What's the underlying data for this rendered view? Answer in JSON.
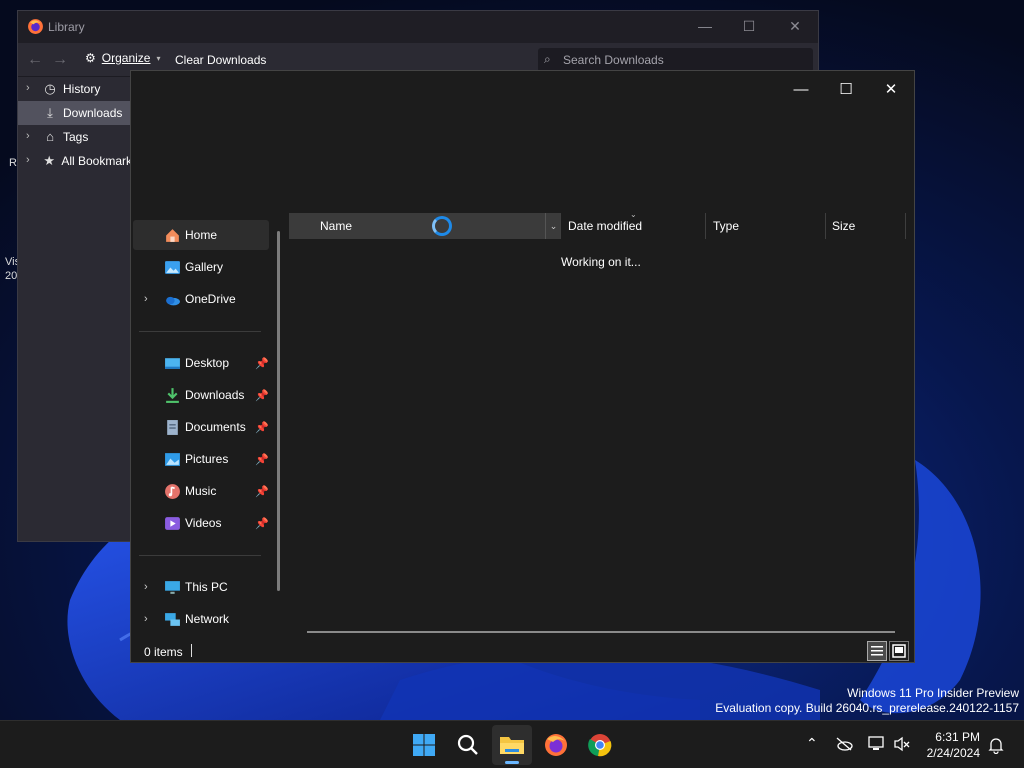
{
  "library": {
    "title": "Library",
    "toolbar": {
      "organize": "Organize",
      "clear": "Clear Downloads"
    },
    "search_placeholder": "Search Downloads",
    "tree": [
      {
        "label": "History",
        "icon": "clock-icon",
        "expandable": true
      },
      {
        "label": "Downloads",
        "icon": "download-icon",
        "expandable": false
      },
      {
        "label": "Tags",
        "icon": "tag-icon",
        "expandable": true
      },
      {
        "label": "All Bookmarks",
        "icon": "star-icon",
        "expandable": true
      }
    ]
  },
  "dialog": {
    "nav": {
      "top": [
        {
          "label": "Home",
          "icon": "home-icon"
        },
        {
          "label": "Gallery",
          "icon": "gallery-icon"
        },
        {
          "label": "OneDrive",
          "icon": "onedrive-icon"
        }
      ],
      "quick_access": [
        {
          "label": "Desktop",
          "icon": "desktop-icon"
        },
        {
          "label": "Downloads",
          "icon": "download-icon"
        },
        {
          "label": "Documents",
          "icon": "documents-icon"
        },
        {
          "label": "Pictures",
          "icon": "pictures-icon"
        },
        {
          "label": "Music",
          "icon": "music-icon"
        },
        {
          "label": "Videos",
          "icon": "videos-icon"
        }
      ],
      "bottom": [
        {
          "label": "This PC",
          "icon": "pc-icon"
        },
        {
          "label": "Network",
          "icon": "network-icon"
        }
      ]
    },
    "columns": {
      "name": "Name",
      "date": "Date modified",
      "type": "Type",
      "size": "Size"
    },
    "status_message": "Working on it...",
    "item_count": "0 items"
  },
  "desktop": {
    "fragments": [
      "R",
      "Vis",
      "20"
    ]
  },
  "watermark": {
    "line1": "Windows 11 Pro Insider Preview",
    "line2": "Evaluation copy. Build 26040.rs_prerelease.240122-1157"
  },
  "taskbar": {
    "apps": [
      "start-icon",
      "search-icon",
      "file-explorer-icon",
      "firefox-icon",
      "chrome-icon"
    ],
    "time": "6:31 PM",
    "date": "2/24/2024"
  },
  "colors": {
    "accent": "#1e8ae8",
    "dialog_bg": "#1c1c1c",
    "library_bg": "#2b2a33"
  }
}
